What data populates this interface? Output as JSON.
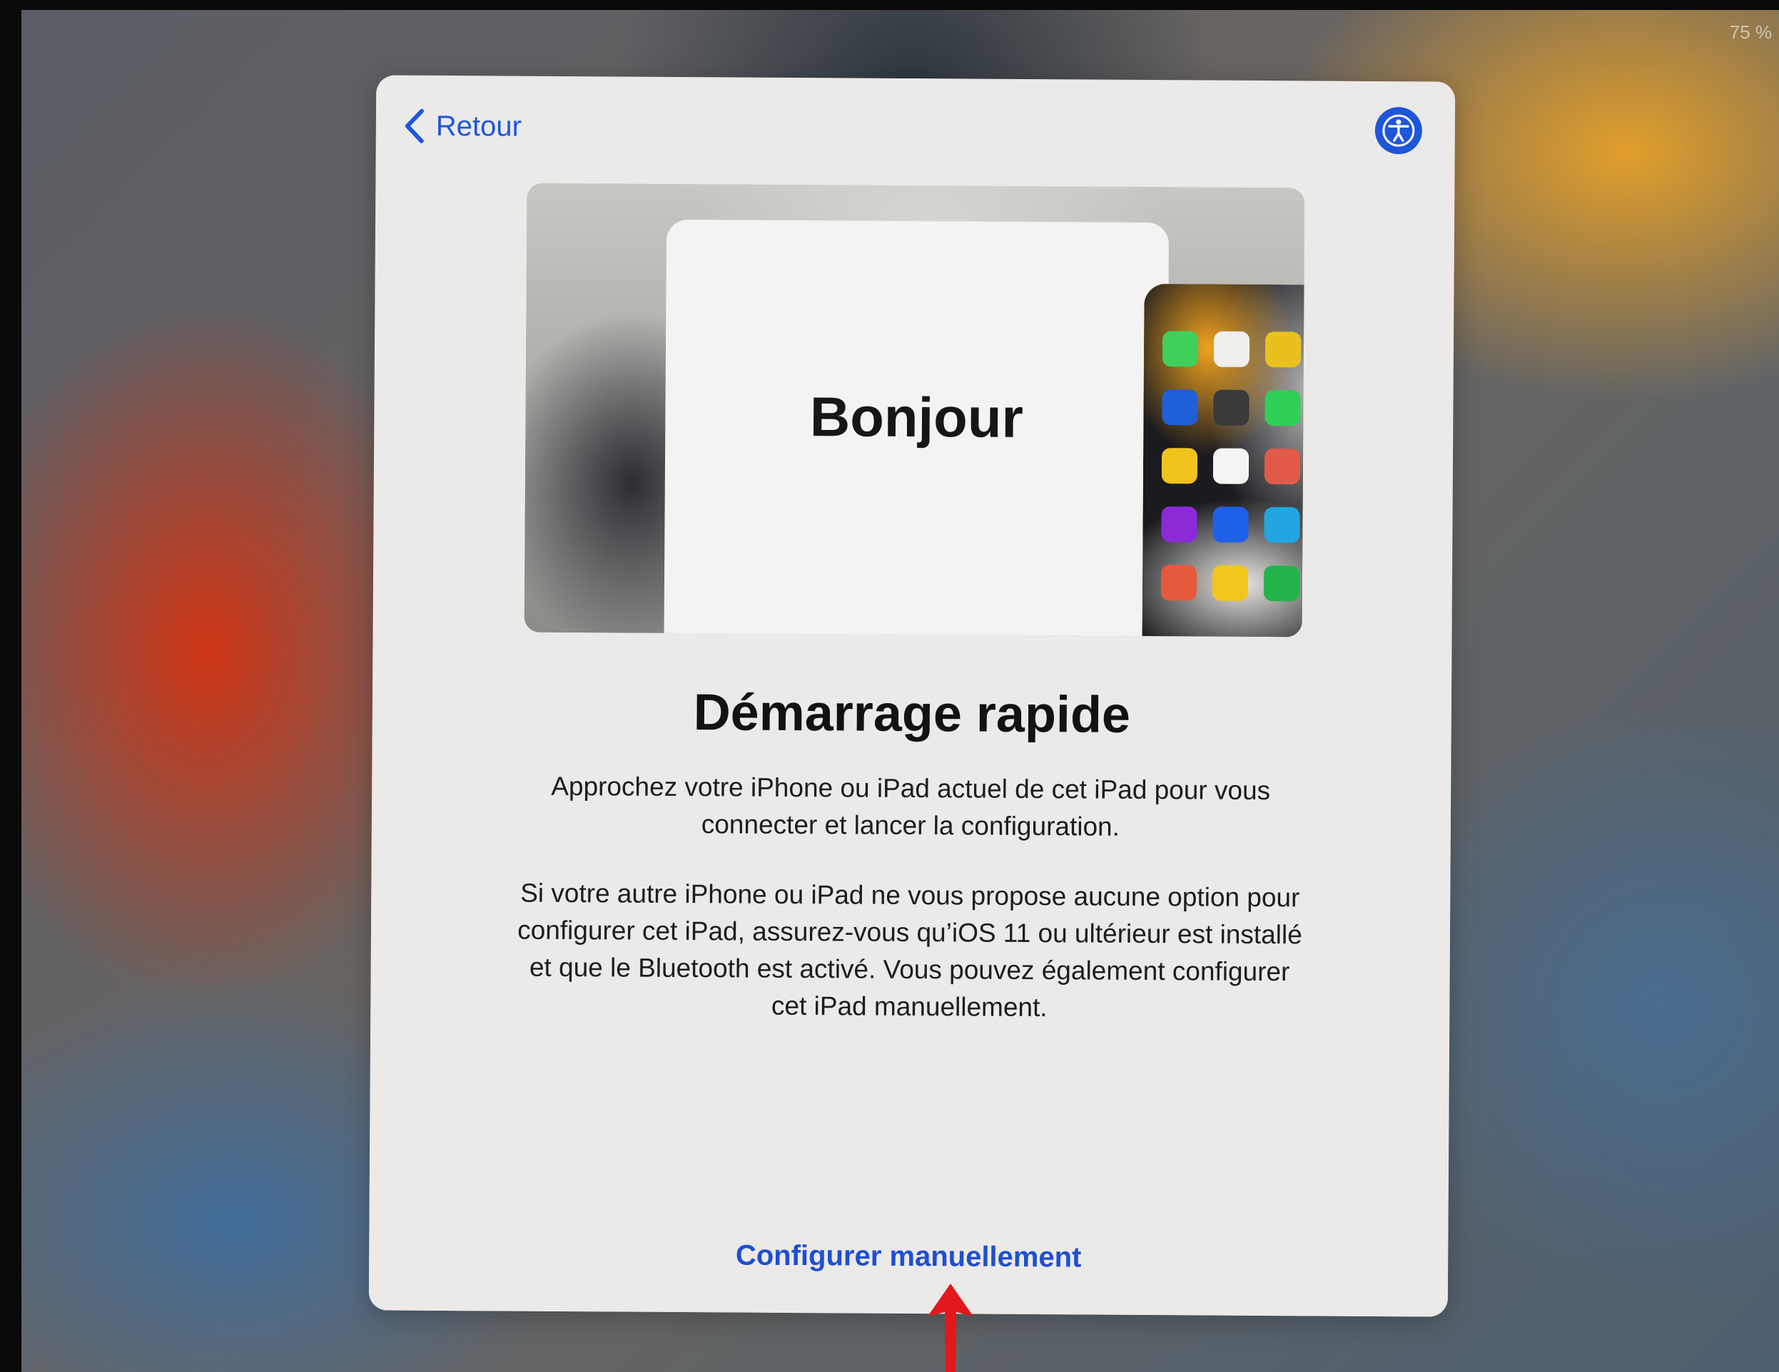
{
  "status_bar": {
    "battery": "75 %"
  },
  "navigation": {
    "back_label": "Retour"
  },
  "hero": {
    "greeting": "Bonjour",
    "app_icon_colors": [
      "#3fcf5b",
      "#f0efeb",
      "#e9c11f",
      "#dcdcdc",
      "#1f5fd8",
      "#3a3a3a",
      "#2fcf58",
      "#1d5fe0",
      "#f2c31c",
      "#f4f4f2",
      "#e25a48",
      "#4a38c8",
      "#8d2ad8",
      "#1e60e6",
      "#23a6e0",
      "#f19f22",
      "#e65a3c",
      "#f1c61b",
      "#23b34a",
      "#d8d8d8"
    ]
  },
  "content": {
    "title": "Démarrage rapide",
    "paragraph_1": "Approchez votre iPhone ou iPad actuel de cet iPad pour vous connecter et lancer la configuration.",
    "paragraph_2": "Si votre autre iPhone ou iPad ne vous propose aucune option pour configurer cet iPad, assurez-vous qu’iOS 11 ou ultérieur est installé et que le Bluetooth est activé. Vous pouvez également configurer cet iPad manuellement."
  },
  "actions": {
    "manual_setup_label": "Configurer manuellement"
  },
  "colors": {
    "accent": "#1f55d8",
    "annotation": "#e3181c"
  }
}
